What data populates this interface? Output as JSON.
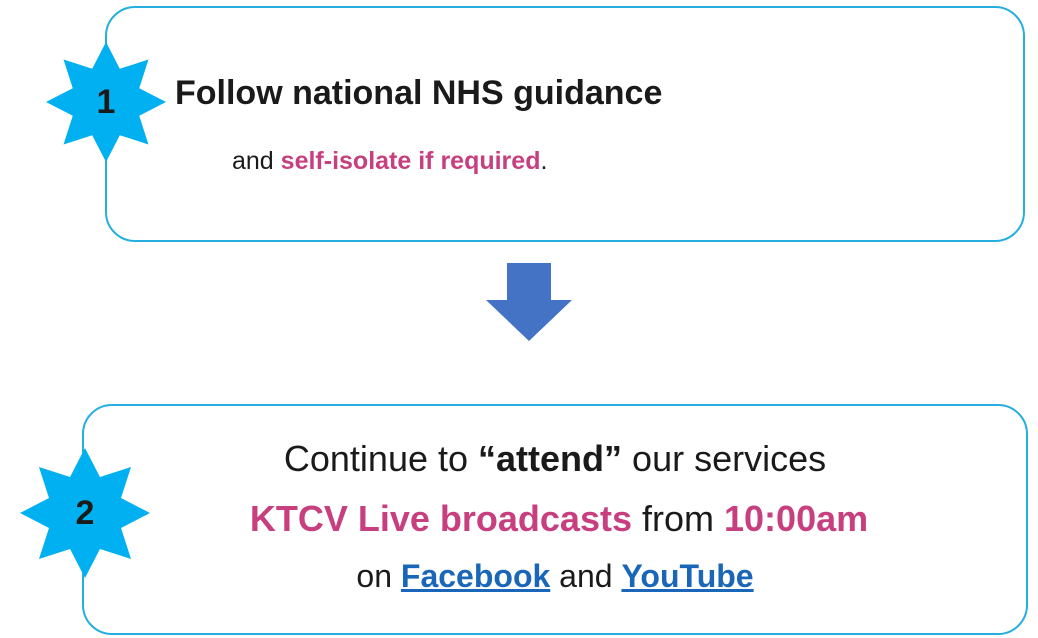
{
  "step1": {
    "number": "1",
    "heading": "Follow national NHS guidance",
    "and": "and",
    "highlight": "self-isolate if required",
    "end": "."
  },
  "step2": {
    "number": "2",
    "line1_pre": "Continue to",
    "line1_bold": "“attend”",
    "line1_post": "our services",
    "line2_a": "KTCV Live broadcasts",
    "line2_b": "from",
    "line2_c": "10:00am",
    "line3_pre": "on",
    "line3_link1": "Facebook",
    "line3_and": "and",
    "line3_link2": "YouTube"
  },
  "colors": {
    "border": "#27aee0",
    "star": "#00b0f0",
    "highlight": "#c73f7e",
    "link": "#1a67b9",
    "arrow": "#4472c4"
  },
  "icons": {
    "step_badge": "eight-point-star-icon",
    "flow": "arrow-down-icon"
  }
}
